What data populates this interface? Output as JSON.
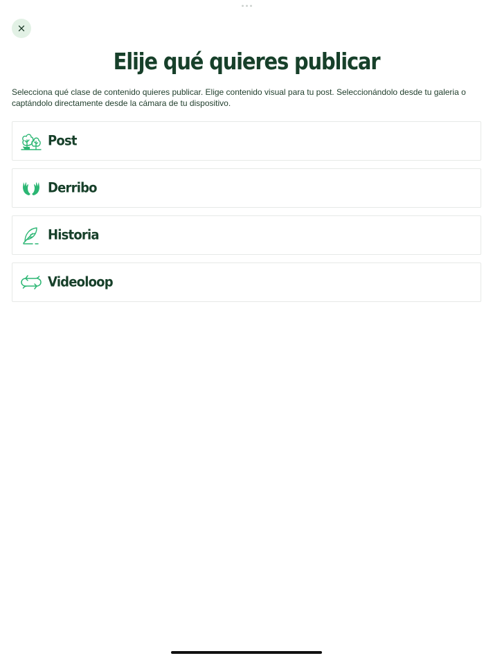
{
  "header": {
    "close_icon": "close-icon",
    "title": "Elije qué quieres publicar",
    "description": "Selecciona qué clase de contenido quieres publicar. Elige contenido visual para tu post. Seleccionándolo desde tu galeria o captándolo directamente desde la cámara de tu dispositivo."
  },
  "options": [
    {
      "label": "Post",
      "icon": "trees-icon"
    },
    {
      "label": "Derribo",
      "icon": "antlers-icon"
    },
    {
      "label": "Historia",
      "icon": "feather-quill-icon"
    },
    {
      "label": "Videoloop",
      "icon": "loop-arrows-icon"
    }
  ],
  "colors": {
    "accent": "#2bb673",
    "title_text": "#17402a",
    "close_bg": "#e2f1e5",
    "card_border": "#e6e9e7"
  }
}
